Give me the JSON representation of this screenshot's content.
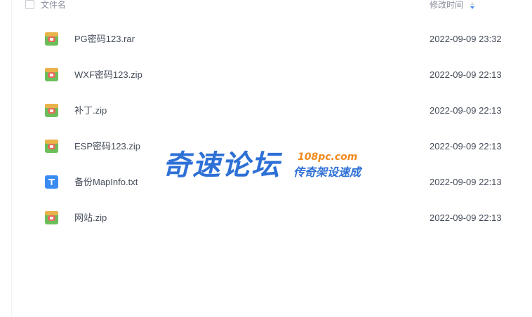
{
  "header": {
    "name_label": "文件名",
    "time_label": "修改时间"
  },
  "files": [
    {
      "name": "PG密码123.rar",
      "time": "2022-09-09 23:32",
      "icon": "archive-icon"
    },
    {
      "name": "WXF密码123.zip",
      "time": "2022-09-09 22:13",
      "icon": "archive-icon"
    },
    {
      "name": "补丁.zip",
      "time": "2022-09-09 22:13",
      "icon": "archive-icon"
    },
    {
      "name": "ESP密码123.zip",
      "time": "2022-09-09 22:13",
      "icon": "archive-icon"
    },
    {
      "name": "备份MapInfo.txt",
      "time": "2022-09-09 22:13",
      "icon": "text-file-icon"
    },
    {
      "name": "网站.zip",
      "time": "2022-09-09 22:13",
      "icon": "archive-icon"
    }
  ],
  "watermark": {
    "title": "奇速论坛",
    "url": "108pc.com",
    "subtitle": "传奇架设速成"
  },
  "colors": {
    "text": "#454d5a",
    "muted": "#878c9c",
    "archive_green": "#6bbf5a",
    "archive_red": "#e66b5b",
    "text_file_blue": "#3b8cf2",
    "watermark_blue": "#2e70d6",
    "watermark_orange": "#f08a1c"
  }
}
